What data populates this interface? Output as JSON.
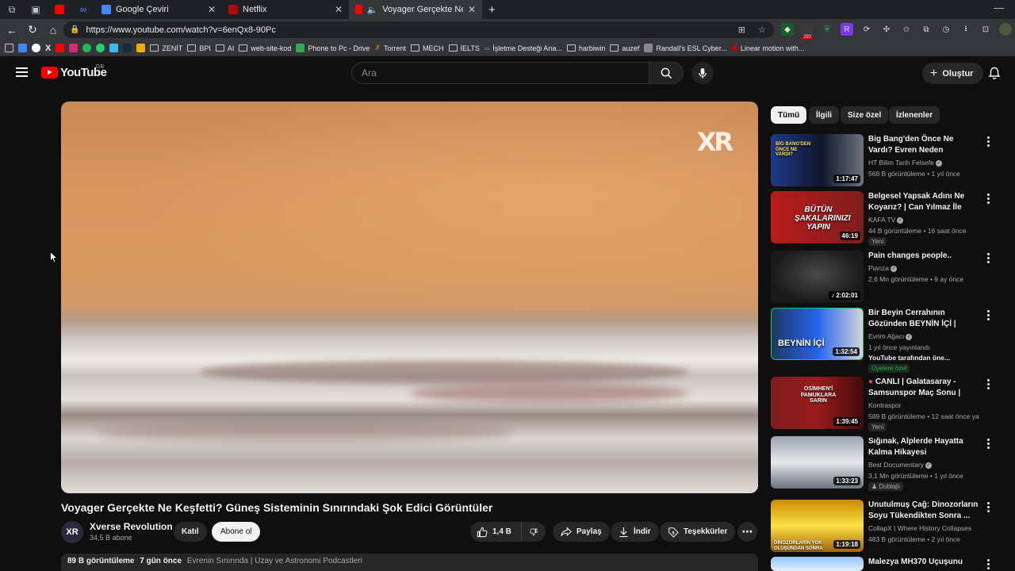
{
  "browser": {
    "tabs": [
      {
        "label": "Google Çeviri"
      },
      {
        "label": "Netflix"
      },
      {
        "label": "Voyager Gerçekte Ne Keşfeti"
      }
    ],
    "url": "https://www.youtube.com/watch?v=6enQx8-90Pc",
    "ext_badge": "293",
    "bookmarks": [
      "ZENİT",
      "BPI",
      "AI",
      "web-site-kod",
      "Phone to Pc - Drive",
      "Torrent",
      "MECH",
      "İELTS",
      "İşletme Desteği Ana...",
      "harbiwin",
      "auzef",
      "Randall's ESL Cyber...",
      "Linear motion with..."
    ]
  },
  "youtube": {
    "logo": "YouTube",
    "region": "GB",
    "search_placeholder": "Ara",
    "create_label": "Oluştur"
  },
  "video": {
    "watermark": "XR",
    "title": "Voyager Gerçekte Ne Keşfetti? Güneş Sisteminin Sınırındaki Şok Edici Görüntüler",
    "channel": "Xverse Revolution",
    "channel_avatar": "XR",
    "subscribers": "34,5 B abone",
    "join_label": "Katıl",
    "subscribe_label": "Abone ol",
    "likes": "1,4 B",
    "share_label": "Paylaş",
    "download_label": "İndir",
    "thanks_label": "Teşekkürler",
    "views": "89 B görüntüleme",
    "age": "7 gün önce",
    "playlist": "Evrenin Sınırında | Uzay ve Astronomi Podcastleri"
  },
  "chips": [
    "Tümü",
    "İlgili",
    "Size özel",
    "İzlenenler"
  ],
  "recommendations": [
    {
      "title": "Big Bang'den Önce Ne Vardı? Evren Neden Genişliyor? Güne...",
      "channel": "HT Bilim Tarih Felsefe",
      "meta": "568 B görüntüleme • 1 yıl önce",
      "duration": "1:17:47",
      "thumb_text": "BİG BANG'DEN ÖNCE NE VARDI?"
    },
    {
      "title": "Belgesel Yapsak Adını Ne Koyarız? | Can Yılmaz İle Geri ...",
      "channel": "KAFA TV",
      "meta": "44 B görüntüleme • 16 saat önce",
      "badge": "Yeni",
      "duration": "46:19",
      "thumb_text": "BÜTÜN ŞAKALARINIZI YAPIN"
    },
    {
      "title": "Pain changes people..",
      "channel": "Pianza",
      "meta": "2,6 Mn görüntüleme • 9 ay önce",
      "duration": "2:02:01"
    },
    {
      "title": "Bir Beyin Cerrahının Gözünden BEYNİN İÇİ | Mehmet Çağlar ...",
      "channel": "Evrim Ağacı",
      "meta": "1 yıl önce yayınlandı",
      "extra": "YouTube tarafından öne...",
      "member": "Üyelere özel",
      "duration": "1:32:54",
      "thumb_text": "BEYNİN İÇİ"
    },
    {
      "title": "CANLI | Galatasaray - Samsunspor Maç Sonu | Nihat...",
      "channel": "Kontraspor",
      "meta": "589 B görüntüleme • 12 saat önce yayınl...",
      "badge": "Yeni",
      "duration": "1:39:45",
      "thumb_text": "OSİMHEN'İ PAMUKLARA SARIN"
    },
    {
      "title": "Sığınak, Alplerde Hayatta Kalma Hikayesi",
      "channel": "Best Documentary",
      "meta": "3,1 Mn görüntüleme • 1 yıl önce",
      "badge": "Dublajlı",
      "duration": "1:33:23"
    },
    {
      "title": "Unutulmuş Çağ: Dinozorların Soyu Tükendikten Sonra ...",
      "channel": "CollapX | Where History Collapses",
      "meta": "483 B görüntüleme • 2 yıl önce",
      "duration": "1:19:18",
      "thumb_text": "DİNOZORLARIN YOK OLUŞUNDAN SONRA"
    },
    {
      "title": "Malezya MH370 Uçuşunu"
    }
  ]
}
